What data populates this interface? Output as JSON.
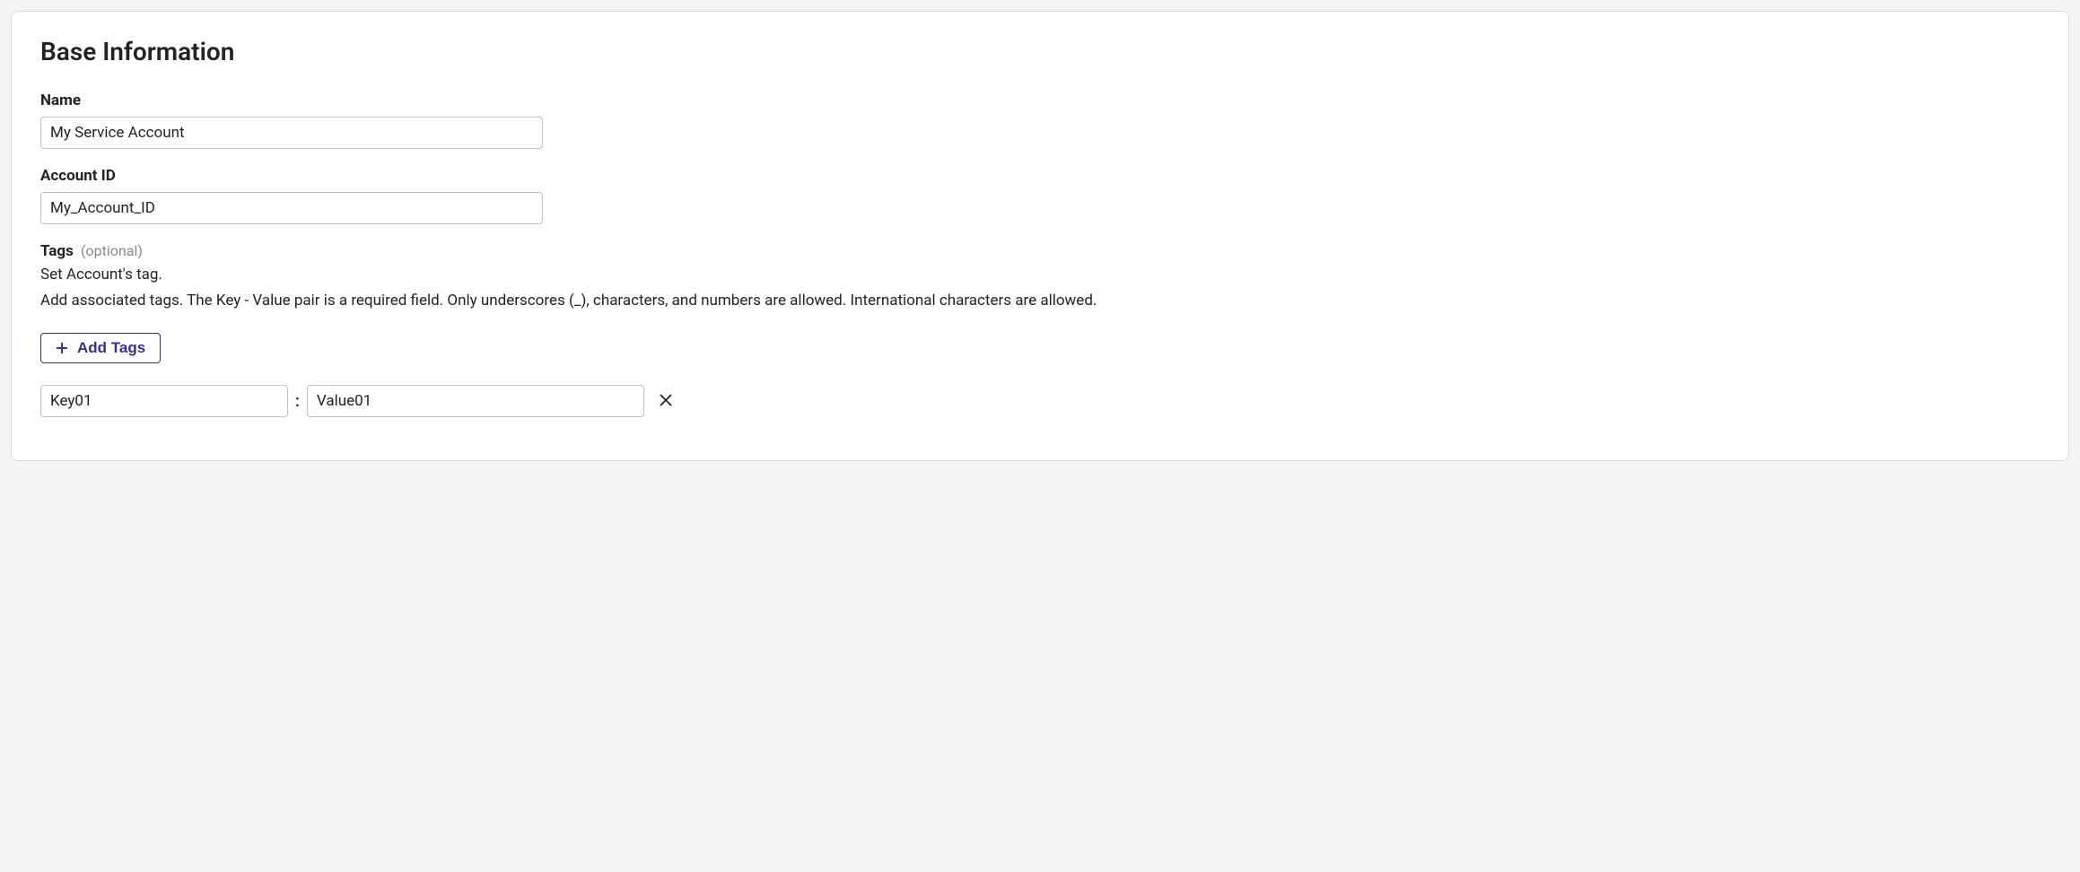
{
  "section": {
    "title": "Base Information"
  },
  "fields": {
    "name": {
      "label": "Name",
      "value": "My Service Account"
    },
    "accountId": {
      "label": "Account ID",
      "value": "My_Account_ID"
    },
    "tags": {
      "label": "Tags",
      "optional": "(optional)",
      "helpLine1": "Set Account's tag.",
      "helpLine2": "Add associated tags. The Key - Value pair is a required field. Only underscores (_), characters, and numbers are allowed. International characters are allowed.",
      "addButtonLabel": "Add Tags",
      "rows": [
        {
          "key": "Key01",
          "value": "Value01"
        }
      ]
    }
  }
}
